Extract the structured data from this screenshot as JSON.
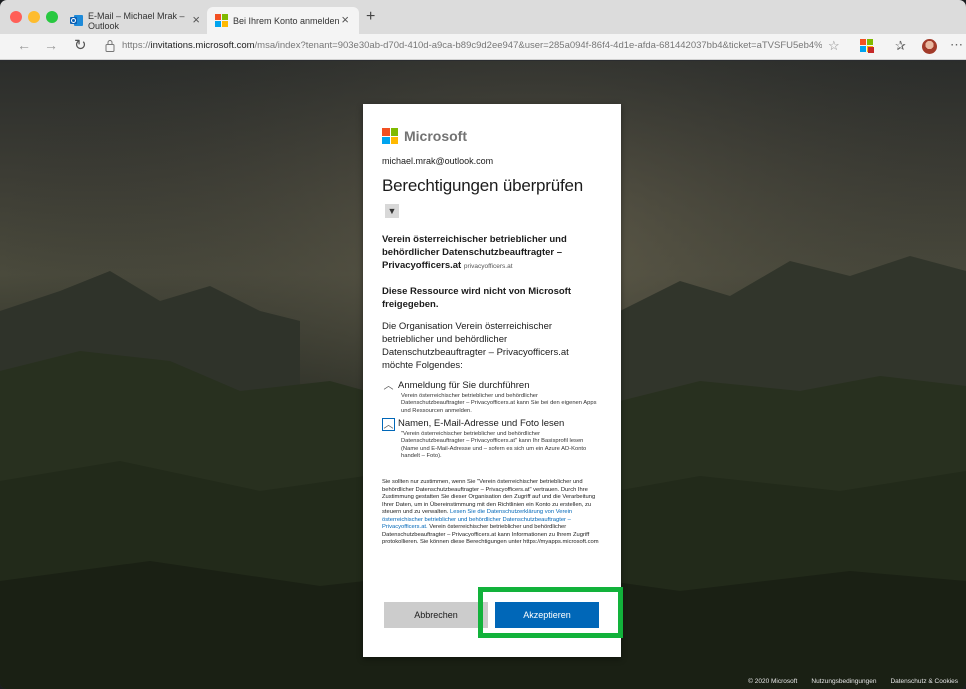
{
  "browser": {
    "tabs": [
      {
        "title": "E-Mail – Michael Mrak – Outlook",
        "active": false
      },
      {
        "title": "Bei Ihrem Konto anmelden",
        "active": true
      }
    ],
    "new_tab": "+",
    "url_prefix": "https://",
    "url_host": "invitations.microsoft.com",
    "url_rest": "/msa/index?tenant=903e30ab-d70d-410d-a9ca-b89c9d2ee947&user=285a094f-86f4-4d1e-afda-681442037bb4&ticket=aTVSFU5eb4%2..."
  },
  "card": {
    "brand": "Microsoft",
    "brand_colors": [
      "#f25022",
      "#7fba00",
      "#00a4ef",
      "#ffb900"
    ],
    "account": "michael.mrak@outlook.com",
    "title": "Berechtigungen überprüfen",
    "org_name": "Verein österreichischer betrieblicher und behördlicher Datenschutzbeauftragter – Privacyofficers.at",
    "org_domain": "privacyofficers.at",
    "not_shared": "Diese Ressource wird nicht von Microsoft freigegeben.",
    "description": "Die Organisation Verein österreichischer betrieblicher und behördlicher Datenschutzbeauftragter – Privacyofficers.at möchte Folgendes:",
    "permissions": [
      {
        "title": "Anmeldung für Sie durchführen",
        "desc": "Verein österreichischer betrieblicher und behördlicher Datenschutzbeauftragter – Privacyofficers.at kann Sie bei den eigenen Apps und Ressourcen anmelden."
      },
      {
        "title": "Namen, E-Mail-Adresse und Foto lesen",
        "desc": "\"Verein österreichischer betrieblicher und behördlicher Datenschutzbeauftragter – Privacyofficers.at\" kann Ihr Basisprofil lesen (Name und E-Mail-Adresse und – sofern es sich um ein Azure AD-Konto handelt – Foto)."
      }
    ],
    "legal_text": "Sie sollten nur zustimmen, wenn Sie \"Verein österreichischer betrieblicher und behördlicher Datenschutzbeauftragter – Privacyofficers.at\" vertrauen. Durch Ihre Zustimmung gestatten Sie dieser Organisation den Zugriff auf und die Verarbeitung Ihrer Daten, um in Übereinstimmung mit den Richtlinien ein Konto zu erstellen, zu steuern und zu verwalten.",
    "legal_link": "Lesen Sie die Datenschutzerklärung von Verein österreichischer betrieblicher und behördlicher Datenschutzbeauftragter – Privacyofficers.at.",
    "legal_text2": "Verein österreichischer betrieblicher und behördlicher Datenschutzbeauftragter – Privacyofficers.at kann Informationen zu Ihrem Zugriff protokollieren. Sie können diese Berechtigungen unter https://myapps.microsoft.com",
    "cancel_label": "Abbrechen",
    "accept_label": "Akzeptieren",
    "highlight_color": "#12b23b"
  },
  "footer": {
    "copyright": "© 2020 Microsoft",
    "terms": "Nutzungsbedingungen",
    "privacy": "Datenschutz & Cookies"
  }
}
